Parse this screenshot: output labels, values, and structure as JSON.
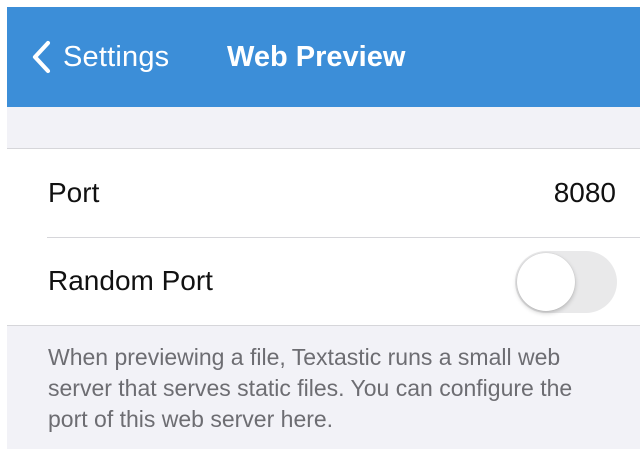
{
  "nav": {
    "back_label": "Settings",
    "title": "Web Preview",
    "back_icon": "chevron-left-icon",
    "bar_color": "#3c8ed8"
  },
  "settings": {
    "port": {
      "label": "Port",
      "value": "8080"
    },
    "random_port": {
      "label": "Random Port",
      "enabled": false
    }
  },
  "footer": {
    "text": "When previewing a file, Textastic runs a small web server that serves static files. You can configure the port of this web server here."
  }
}
